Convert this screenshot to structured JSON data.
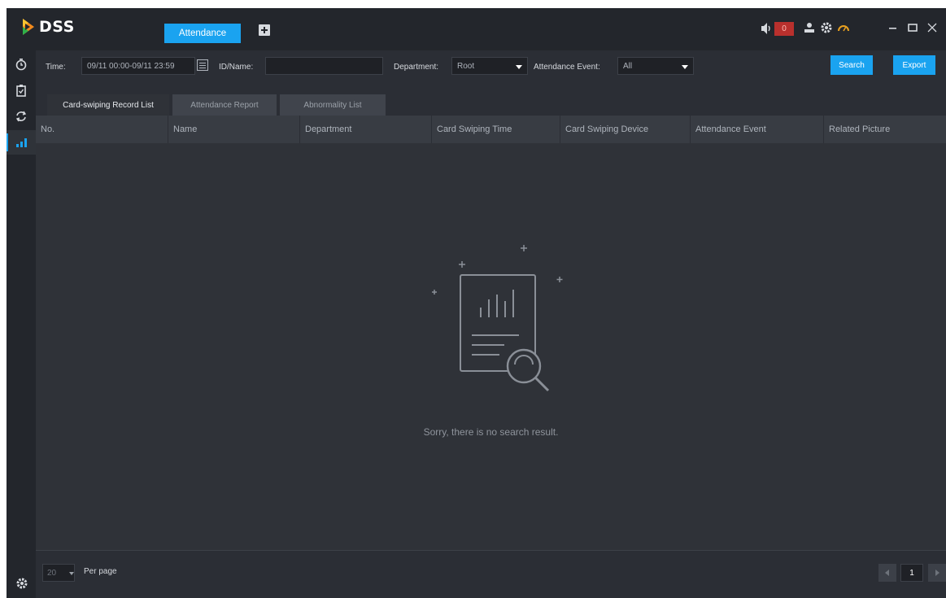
{
  "app": {
    "logo_text": "DSS",
    "active_tab": "Attendance",
    "alarm_count": "0"
  },
  "filters": {
    "time_label": "Time:",
    "time_value": "09/11 00:00-09/11 23:59",
    "idname_label": "ID/Name:",
    "idname_value": "",
    "department_label": "Department:",
    "department_value": "Root",
    "event_label": "Attendance Event:",
    "event_value": "All",
    "search_label": "Search",
    "export_label": "Export"
  },
  "tabs": [
    {
      "label": "Card-swiping Record List",
      "active": true
    },
    {
      "label": "Attendance Report",
      "active": false
    },
    {
      "label": "Abnormality List",
      "active": false
    }
  ],
  "table": {
    "columns": [
      "No.",
      "Name",
      "Department",
      "Card Swiping Time",
      "Card Swiping Device",
      "Attendance Event",
      "Related Picture"
    ],
    "rows": [],
    "empty_message": "Sorry, there is no search result."
  },
  "pagination": {
    "per_page_value": "20",
    "per_page_label": "Per page",
    "current_page": "1"
  },
  "sidebar": {
    "items": [
      {
        "icon": "clock-icon",
        "active": false
      },
      {
        "icon": "clipboard-check-icon",
        "active": false
      },
      {
        "icon": "sync-icon",
        "active": false
      },
      {
        "icon": "bar-chart-icon",
        "active": true
      }
    ]
  },
  "colors": {
    "accent": "#1aa3f0",
    "alarm": "#b9302d",
    "background": "#2b2e35"
  }
}
